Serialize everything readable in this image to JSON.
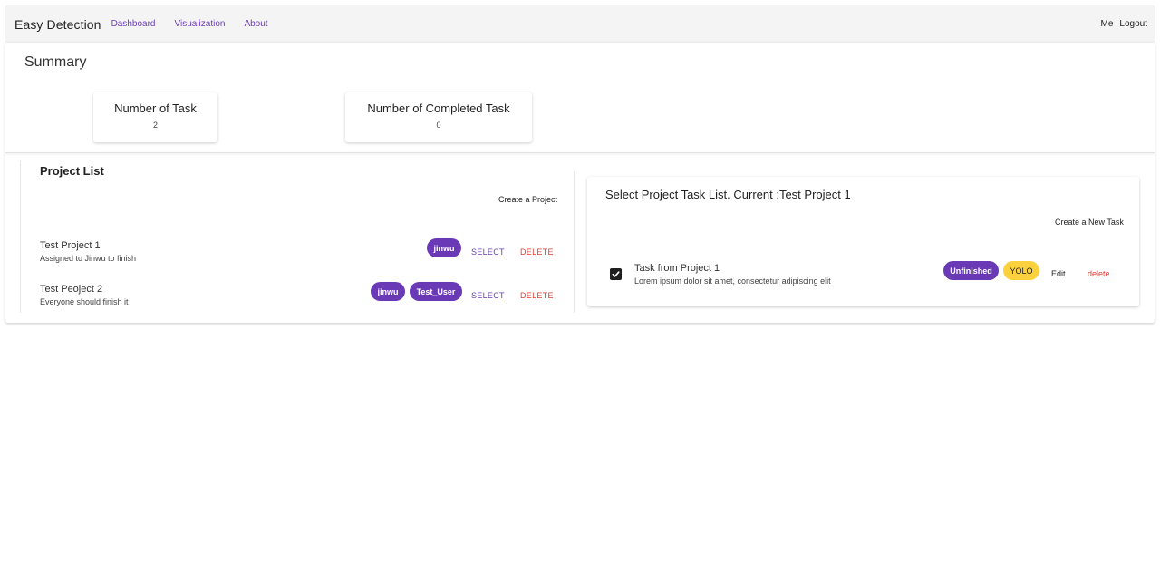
{
  "nav": {
    "brand": "Easy Detection",
    "links": [
      "Dashboard",
      "Visualization",
      "About"
    ],
    "me": "Me",
    "logout": "Logout"
  },
  "summary": {
    "title": "Summary",
    "stats": [
      {
        "label": "Number of Task",
        "value": "2"
      },
      {
        "label": "Number of Completed Task",
        "value": "0"
      }
    ]
  },
  "projects": {
    "title": "Project List",
    "create_label": "Create a Project",
    "select_label": "SELECT",
    "delete_label": "DELETE",
    "items": [
      {
        "name": "Test Project 1",
        "description": "Assigned to Jinwu to finish",
        "users": [
          "jinwu"
        ]
      },
      {
        "name": "Test Peoject 2",
        "description": "Everyone should finish it",
        "users": [
          "jinwu",
          "Test_User"
        ]
      }
    ]
  },
  "tasks": {
    "title": "Select Project Task List. Current :Test Project 1",
    "create_label": "Create a New Task",
    "items": [
      {
        "name": "Task from Project 1",
        "description": "Lorem ipsum dolor sit amet, consectetur adipiscing elit",
        "checked": true,
        "status": "Unfinished",
        "model": "YOLO",
        "edit_label": "Edit",
        "delete_label": "delete"
      }
    ]
  },
  "colors": {
    "accent": "#6a3ab6",
    "danger": "#e53935",
    "yolo_chip": "#fbd13d",
    "navbar_bg": "#f4f4f4"
  }
}
